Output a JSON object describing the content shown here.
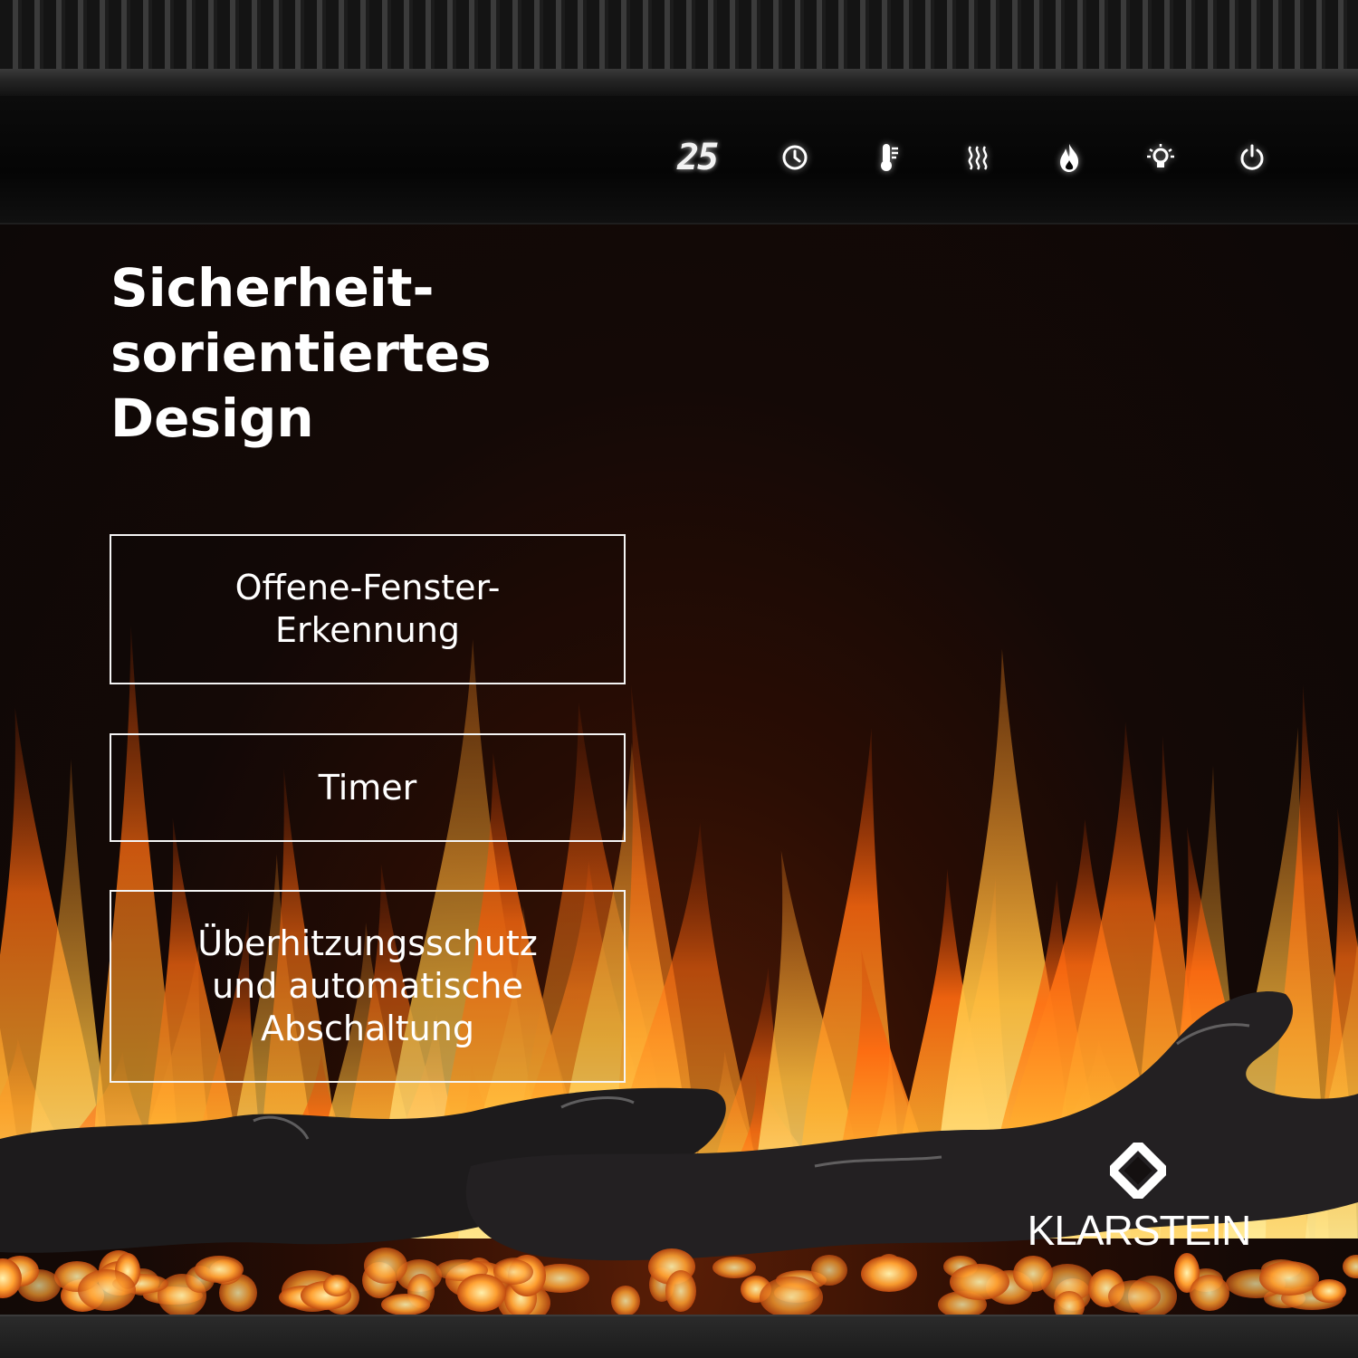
{
  "control_panel": {
    "temperature_display": "25",
    "icons": [
      "timer-icon",
      "thermometer-icon",
      "heat-icon",
      "flame-icon",
      "light-bulb-icon",
      "power-icon"
    ]
  },
  "headline": {
    "lines": [
      "Sicherheit-",
      "sorientiertes",
      "Design"
    ]
  },
  "features": [
    {
      "lines": [
        "Offene-Fenster-",
        "Erkennung"
      ]
    },
    {
      "lines": [
        "Timer"
      ]
    },
    {
      "lines": [
        "Überhitzungsschutz",
        "und automatische",
        "Abschaltung"
      ]
    }
  ],
  "brand": {
    "name": "KLARSTEIN"
  },
  "colors": {
    "text": "#ffffff",
    "flame": "#ff6a10",
    "panel": "#050505"
  }
}
